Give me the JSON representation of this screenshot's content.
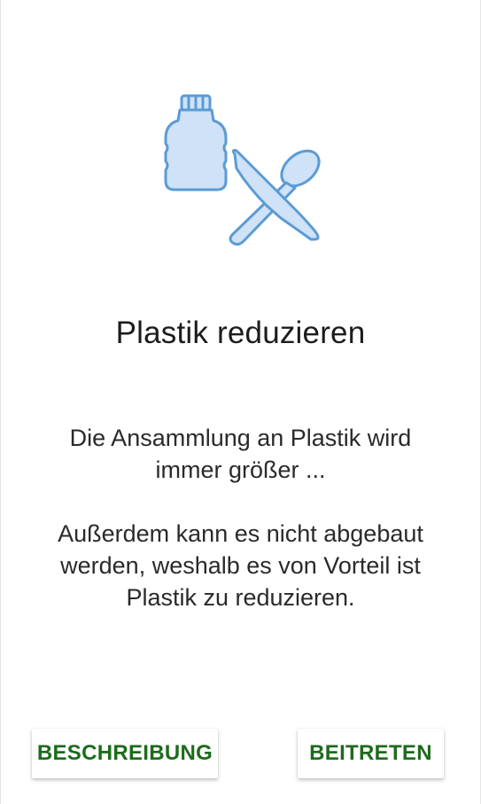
{
  "screen": {
    "icon": "plastic-bottle-and-cutlery-icon",
    "accent_color": "#1d6b1d",
    "icon_stroke_color": "#5b9bd5",
    "icon_fill_color": "#cfe2f7",
    "title": "Plastik reduzieren",
    "description_1": "Die Ansammlung an Plastik wird immer größer ...",
    "description_2": "Außerdem kann es nicht abgebaut werden, weshalb es von Vorteil ist Plastik zu reduzieren."
  },
  "buttons": {
    "description_label": "BESCHREIBUNG",
    "join_label": "BEITRETEN"
  }
}
